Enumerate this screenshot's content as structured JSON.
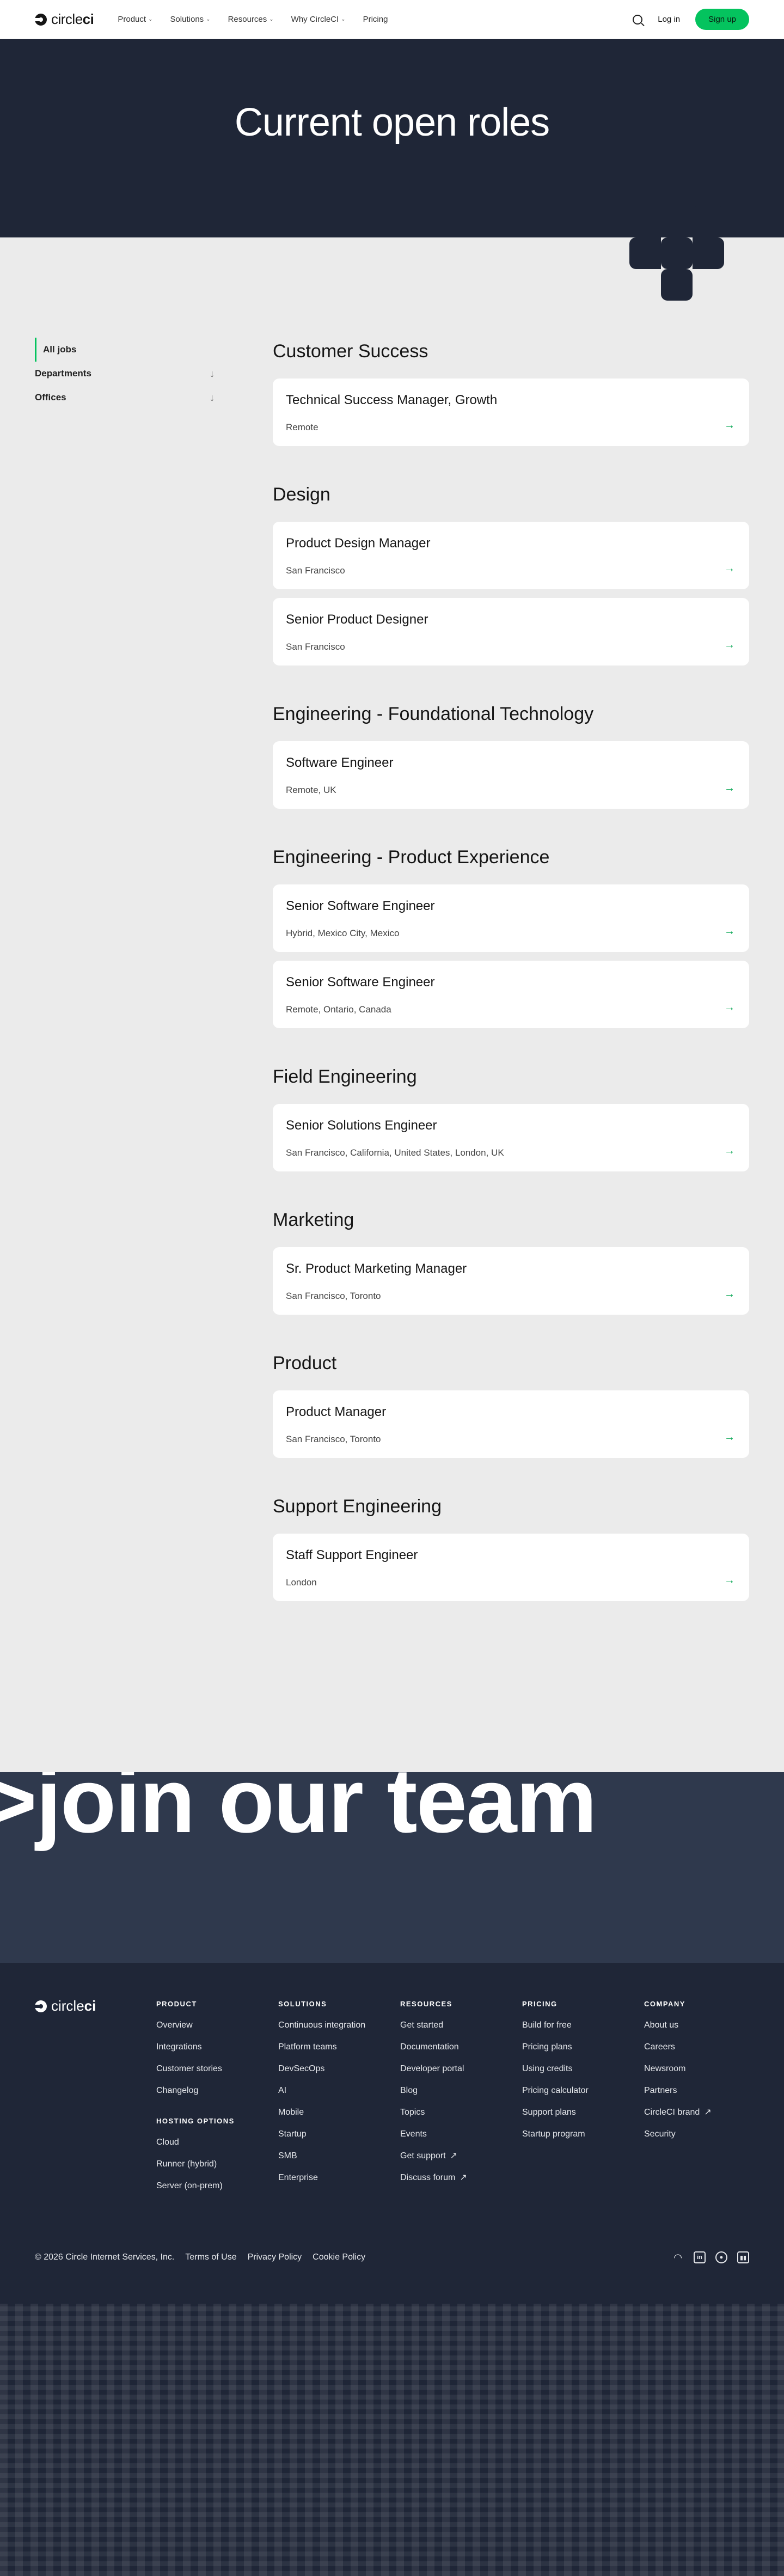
{
  "nav": {
    "logo_prefix": "circle",
    "logo_suffix": "ci",
    "links": [
      "Product",
      "Solutions",
      "Resources",
      "Why CircleCI",
      "Pricing"
    ],
    "login": "Log in",
    "signup": "Sign up"
  },
  "hero": {
    "title": "Current open roles"
  },
  "sidebar": {
    "all": "All jobs",
    "departments": "Departments",
    "offices": "Offices"
  },
  "departments": [
    {
      "name": "Customer Success",
      "jobs": [
        {
          "title": "Technical Success Manager, Growth",
          "location": "Remote"
        }
      ]
    },
    {
      "name": "Design",
      "jobs": [
        {
          "title": "Product Design Manager",
          "location": "San Francisco"
        },
        {
          "title": "Senior Product Designer",
          "location": "San Francisco"
        }
      ]
    },
    {
      "name": "Engineering - Foundational Technology",
      "jobs": [
        {
          "title": "Software Engineer",
          "location": "Remote, UK"
        }
      ]
    },
    {
      "name": "Engineering - Product Experience",
      "jobs": [
        {
          "title": "Senior Software Engineer",
          "location": "Hybrid, Mexico City, Mexico"
        },
        {
          "title": "Senior Software Engineer",
          "location": "Remote, Ontario, Canada"
        }
      ]
    },
    {
      "name": "Field Engineering",
      "jobs": [
        {
          "title": "Senior Solutions Engineer",
          "location": "San Francisco, California, United States, London, UK"
        }
      ]
    },
    {
      "name": "Marketing",
      "jobs": [
        {
          "title": "Sr. Product Marketing Manager",
          "location": "San Francisco, Toronto"
        }
      ]
    },
    {
      "name": "Product",
      "jobs": [
        {
          "title": "Product Manager",
          "location": "San Francisco, Toronto"
        }
      ]
    },
    {
      "name": "Support Engineering",
      "jobs": [
        {
          "title": "Staff Support Engineer",
          "location": "London"
        }
      ]
    }
  ],
  "banner": {
    "text": ">join our team"
  },
  "footer": {
    "product": {
      "heading": "PRODUCT",
      "items": [
        "Overview",
        "Integrations",
        "Customer stories",
        "Changelog"
      ]
    },
    "hosting": {
      "heading": "HOSTING OPTIONS",
      "items": [
        "Cloud",
        "Runner (hybrid)",
        "Server (on-prem)"
      ]
    },
    "solutions": {
      "heading": "SOLUTIONS",
      "items": [
        "Continuous integration",
        "Platform teams",
        "DevSecOps",
        "AI",
        "Mobile",
        "Startup",
        "SMB",
        "Enterprise"
      ]
    },
    "resources": {
      "heading": "RESOURCES",
      "items": [
        "Get started",
        "Documentation",
        "Developer portal",
        "Blog",
        "Topics",
        "Events",
        "Get support",
        "Discuss forum"
      ]
    },
    "pricing": {
      "heading": "PRICING",
      "items": [
        "Build for free",
        "Pricing plans",
        "Using credits",
        "Pricing calculator",
        "Support plans",
        "Startup program"
      ]
    },
    "company": {
      "heading": "COMPANY",
      "items": [
        "About us",
        "Careers",
        "Newsroom",
        "Partners",
        "CircleCI brand",
        "Security"
      ]
    },
    "copyright": "© 2026 Circle Internet Services, Inc.",
    "terms": "Terms of Use",
    "privacy": "Privacy Policy",
    "cookie": "Cookie Policy"
  },
  "colors": {
    "accent": "#04c35e",
    "navy": "#1f2637",
    "banner": "#2f394d"
  }
}
